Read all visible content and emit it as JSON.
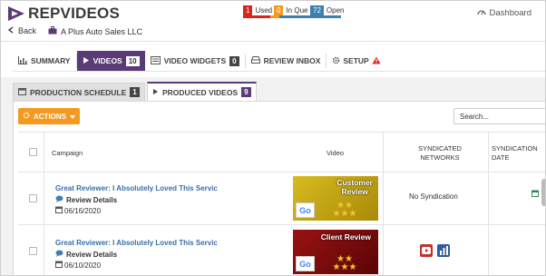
{
  "app": {
    "logo_text": "REPVIDEOS"
  },
  "stats": [
    {
      "count": "1",
      "label": "Used",
      "color": "#d9251c"
    },
    {
      "count": "0",
      "label": "In Que",
      "color": "#f49a22"
    },
    {
      "count": "72",
      "label": "Open",
      "color": "#3e7fb2"
    }
  ],
  "header": {
    "dashboard_label": "Dashboard"
  },
  "backbar": {
    "back_label": "Back",
    "company_name": "A Plus Auto Sales LLC"
  },
  "nav": {
    "summary": "SUMMARY",
    "videos": "VIDEOS",
    "videos_count": "10",
    "widgets": "VIDEO WIDGETS",
    "widgets_count": "0",
    "review_inbox": "REVIEW INBOX",
    "setup": "SETUP"
  },
  "subtabs": {
    "production_schedule": "PRODUCTION SCHEDULE",
    "production_count": "1",
    "produced_videos": "PRODUCED VIDEOS",
    "produced_count": "9"
  },
  "toolbar": {
    "actions_label": "ACTIONS",
    "search_placeholder": "Search..."
  },
  "table": {
    "columns": {
      "campaign": "Campaign",
      "video": "Video",
      "networks_1": "SYNDICATED",
      "networks_2": "NETWORKS",
      "date_1": "SYNDICATION",
      "date_2": "DATE"
    },
    "rows": [
      {
        "title": "Great Reviewer: I Absolutely Loved This Servic",
        "details": "Review Details",
        "date": "06/16/2020",
        "thumb_label_1": "Customer",
        "thumb_label_2": "Review",
        "thumb_google": "Go",
        "syndication": "No Syndication",
        "thumb_color": "#c8a814"
      },
      {
        "title": "Great Reviewer: I Absolutely Loved This Servic",
        "details": "Review Details",
        "date": "06/10/2020",
        "thumb_label_1": "Client Review",
        "thumb_label_2": "",
        "thumb_google": "Go",
        "syndication": "",
        "thumb_color": "#8b1010"
      }
    ]
  }
}
